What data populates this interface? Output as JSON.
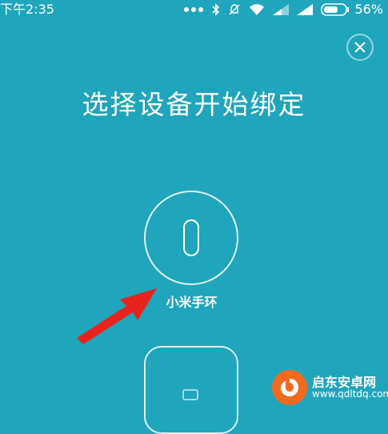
{
  "status_bar": {
    "time": "下午2:35",
    "battery": "56%",
    "icons": [
      "bluetooth-icon",
      "mute-bell-icon",
      "wifi-icon",
      "signal-icon",
      "signal-icon",
      "battery-icon"
    ]
  },
  "close_icon": "close-icon",
  "title": "选择设备开始绑定",
  "devices": [
    {
      "label": "小米手环",
      "icon": "band-icon"
    },
    {
      "label": "",
      "icon": "mi-logo-icon"
    }
  ],
  "watermark": {
    "name": "启东安卓网",
    "url": "www.qdltdq.com"
  },
  "colors": {
    "background": "#1fa5bc",
    "arrow": "#e8231c",
    "watermark_logo": "#f36a1f"
  }
}
